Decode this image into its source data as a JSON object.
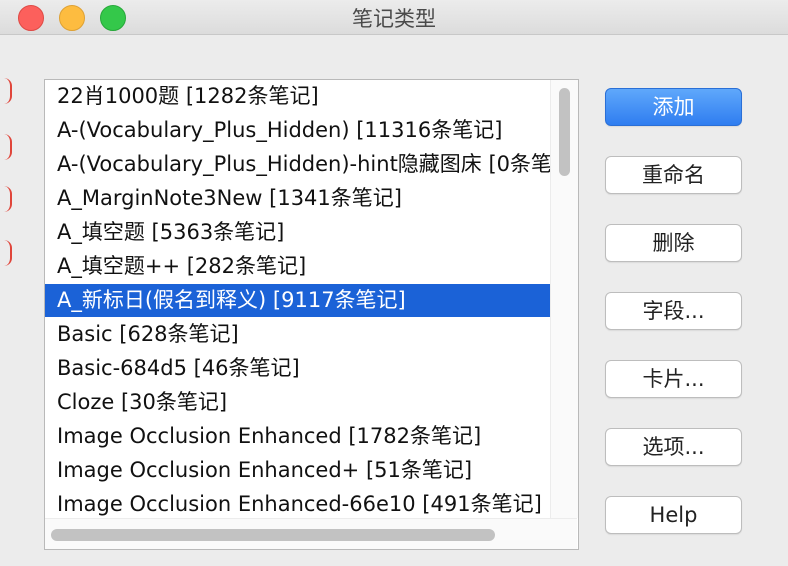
{
  "window": {
    "title": "笔记类型"
  },
  "list": {
    "items": [
      "22肖1000题 [1282条笔记]",
      "A-(Vocabulary_Plus_Hidden) [11316条笔记]",
      "A-(Vocabulary_Plus_Hidden)-hint隐藏图床 [0条笔记]",
      "A_MarginNote3New [1341条笔记]",
      "A_填空题 [5363条笔记]",
      "A_填空题++ [282条笔记]",
      "A_新标日(假名到释义) [9117条笔记]",
      "Basic [628条笔记]",
      "Basic-684d5 [46条笔记]",
      "Cloze [30条笔记]",
      "Image Occlusion Enhanced [1782条笔记]",
      "Image Occlusion Enhanced+ [51条笔记]",
      "Image Occlusion Enhanced-66e10 [491条笔记]"
    ],
    "selected_index": 6
  },
  "buttons": {
    "add": "添加",
    "rename": "重命名",
    "delete": "删除",
    "fields": "字段...",
    "cards": "卡片...",
    "options": "选项...",
    "help": "Help"
  },
  "colors": {
    "selection": "#1b62d7",
    "primary_button": "#2f7df0",
    "close": "#fc605c",
    "minimize": "#fdbc40",
    "zoom": "#34c84a"
  }
}
